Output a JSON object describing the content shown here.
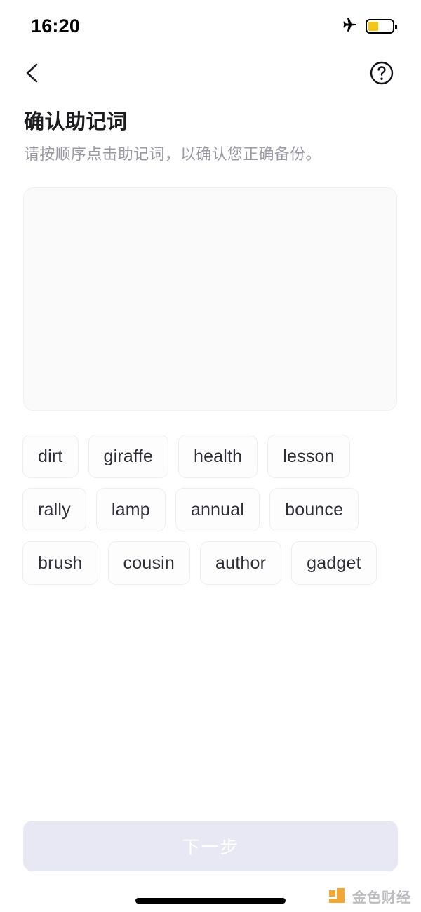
{
  "status_bar": {
    "time": "16:20",
    "airplane_icon": "airplane-mode-icon",
    "battery_icon": "battery-low-power-icon",
    "battery_level_percent": 43,
    "battery_fill_color": "#f5c518"
  },
  "nav": {
    "back_icon": "chevron-left-icon",
    "help_icon": "question-mark-circle-icon"
  },
  "header": {
    "title": "确认助记词",
    "subtitle": "请按顺序点击助记词，以确认您正确备份。"
  },
  "answer_box": {
    "selected_words": [],
    "background_color": "#fafafb",
    "border_color": "#f0f0f2"
  },
  "word_pool": {
    "words": [
      "dirt",
      "giraffe",
      "health",
      "lesson",
      "rally",
      "lamp",
      "annual",
      "bounce",
      "brush",
      "cousin",
      "author",
      "gadget"
    ],
    "chip_background": "#fdfdfd",
    "chip_border": "#eeeef0",
    "chip_text_color": "#2f2f38"
  },
  "cta": {
    "label": "下一步",
    "disabled": true,
    "background_color": "#e8e8f4",
    "text_color": "#ffffff"
  },
  "watermark": {
    "text": "金色财经",
    "logo_color": "#f0a020",
    "text_color": "#b8b8bc"
  },
  "home_indicator": {
    "color": "#000000"
  }
}
